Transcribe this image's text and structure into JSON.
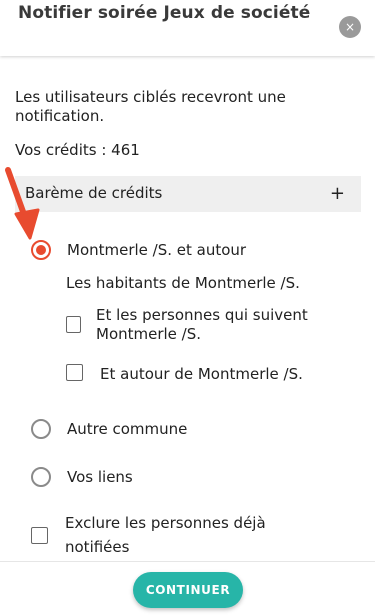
{
  "header": {
    "title": "Notifier soirée Jeux de société",
    "close_label": "×"
  },
  "intro_text": "Les utilisateurs ciblés recevront une notification.",
  "credits_text": "Vos crédits : 461",
  "bareme": {
    "label": "Barème de crédits",
    "toggle": "+"
  },
  "options": {
    "montmerle": {
      "label": "Montmerle /S. et autour",
      "selected": true,
      "sub_heading": "Les habitants de Montmerle /S.",
      "followers_label_line1": "Et les personnes qui suivent",
      "followers_label_line2": "Montmerle /S.",
      "followers_checked": false,
      "around_label": "Et autour de Montmerle /S.",
      "around_checked": false
    },
    "autre_commune": {
      "label": "Autre commune",
      "selected": false
    },
    "vos_liens": {
      "label": "Vos liens",
      "selected": false
    }
  },
  "exclude": {
    "label_line1": "Exclure les personnes déjà",
    "label_line2": "notifiées",
    "checked": false
  },
  "footer": {
    "continue_label": "CONTINUER"
  },
  "colors": {
    "accent": "#e84b2f",
    "button": "#27b5a8",
    "panel": "#efefef"
  }
}
